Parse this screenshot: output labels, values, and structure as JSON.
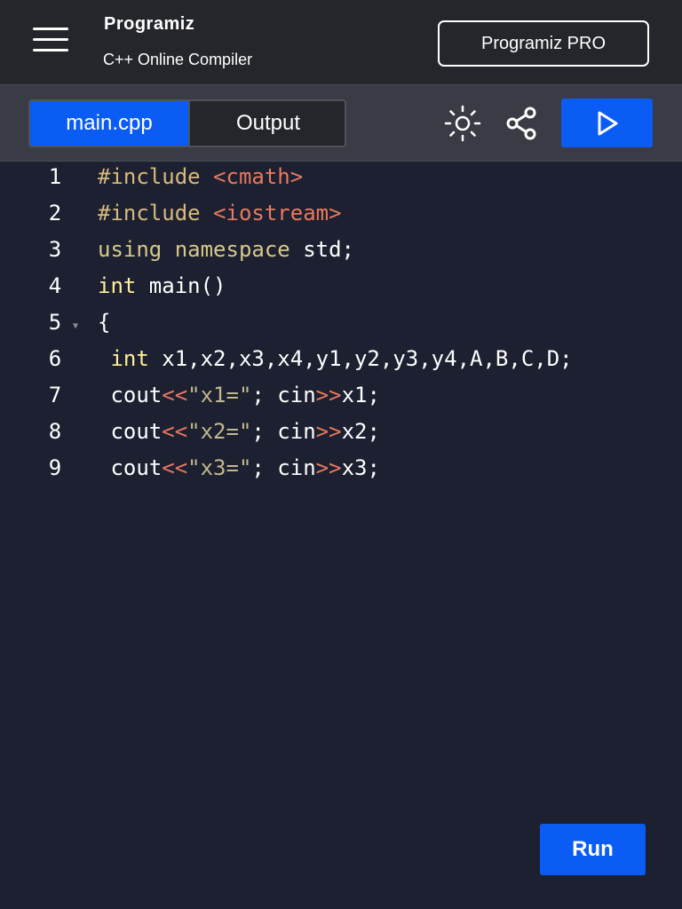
{
  "header": {
    "brand": "Programiz",
    "subtitle": "C++ Online Compiler",
    "pro_button": "Programiz PRO",
    "menu_icon": "hamburger-menu-icon"
  },
  "toolbar": {
    "tabs": [
      {
        "label": "main.cpp",
        "active": true
      },
      {
        "label": "Output",
        "active": false
      }
    ],
    "icons": [
      "theme-toggle-sun-icon",
      "share-icon",
      "run-play-icon"
    ],
    "accent_color": "#0b5cf5"
  },
  "editor": {
    "lines": [
      {
        "n": "1",
        "tokens": [
          {
            "t": "#include ",
            "c": "kw-pre"
          },
          {
            "t": "<cmath>",
            "c": "str-inc"
          }
        ]
      },
      {
        "n": "2",
        "tokens": [
          {
            "t": "#include ",
            "c": "kw-pre"
          },
          {
            "t": "<iostream>",
            "c": "str-inc"
          }
        ]
      },
      {
        "n": "3",
        "tokens": [
          {
            "t": "using namespace ",
            "c": "kw-ns"
          },
          {
            "t": "std;",
            "c": ""
          }
        ]
      },
      {
        "n": "4",
        "tokens": [
          {
            "t": "int",
            "c": "kw-type"
          },
          {
            "t": " main()",
            "c": ""
          }
        ]
      },
      {
        "n": "5",
        "tokens": [
          {
            "t": "{",
            "c": ""
          }
        ],
        "fold": true
      },
      {
        "n": "6",
        "tokens": [
          {
            "t": " int",
            "c": "kw-type"
          },
          {
            "t": " x1,x2,x3,x4,y1,y2,y3,y4,A,B,C,D;",
            "c": ""
          }
        ]
      },
      {
        "n": "7",
        "tokens": [
          {
            "t": " cout",
            "c": ""
          },
          {
            "t": "<<",
            "c": "op"
          },
          {
            "t": "\"x1=\"",
            "c": "str"
          },
          {
            "t": "; cin",
            "c": ""
          },
          {
            "t": ">>",
            "c": "op"
          },
          {
            "t": "x1;",
            "c": ""
          }
        ]
      },
      {
        "n": "8",
        "tokens": [
          {
            "t": " cout",
            "c": ""
          },
          {
            "t": "<<",
            "c": "op"
          },
          {
            "t": "\"x2=\"",
            "c": "str"
          },
          {
            "t": "; cin",
            "c": ""
          },
          {
            "t": ">>",
            "c": "op"
          },
          {
            "t": "x2;",
            "c": ""
          }
        ]
      },
      {
        "n": "9",
        "tokens": [
          {
            "t": " cout",
            "c": ""
          },
          {
            "t": "<<",
            "c": "op"
          },
          {
            "t": "\"x3=\"",
            "c": "str"
          },
          {
            "t": "; cin",
            "c": ""
          },
          {
            "t": ">>",
            "c": "op"
          },
          {
            "t": "x3;",
            "c": ""
          }
        ]
      }
    ]
  },
  "run_button": "Run"
}
